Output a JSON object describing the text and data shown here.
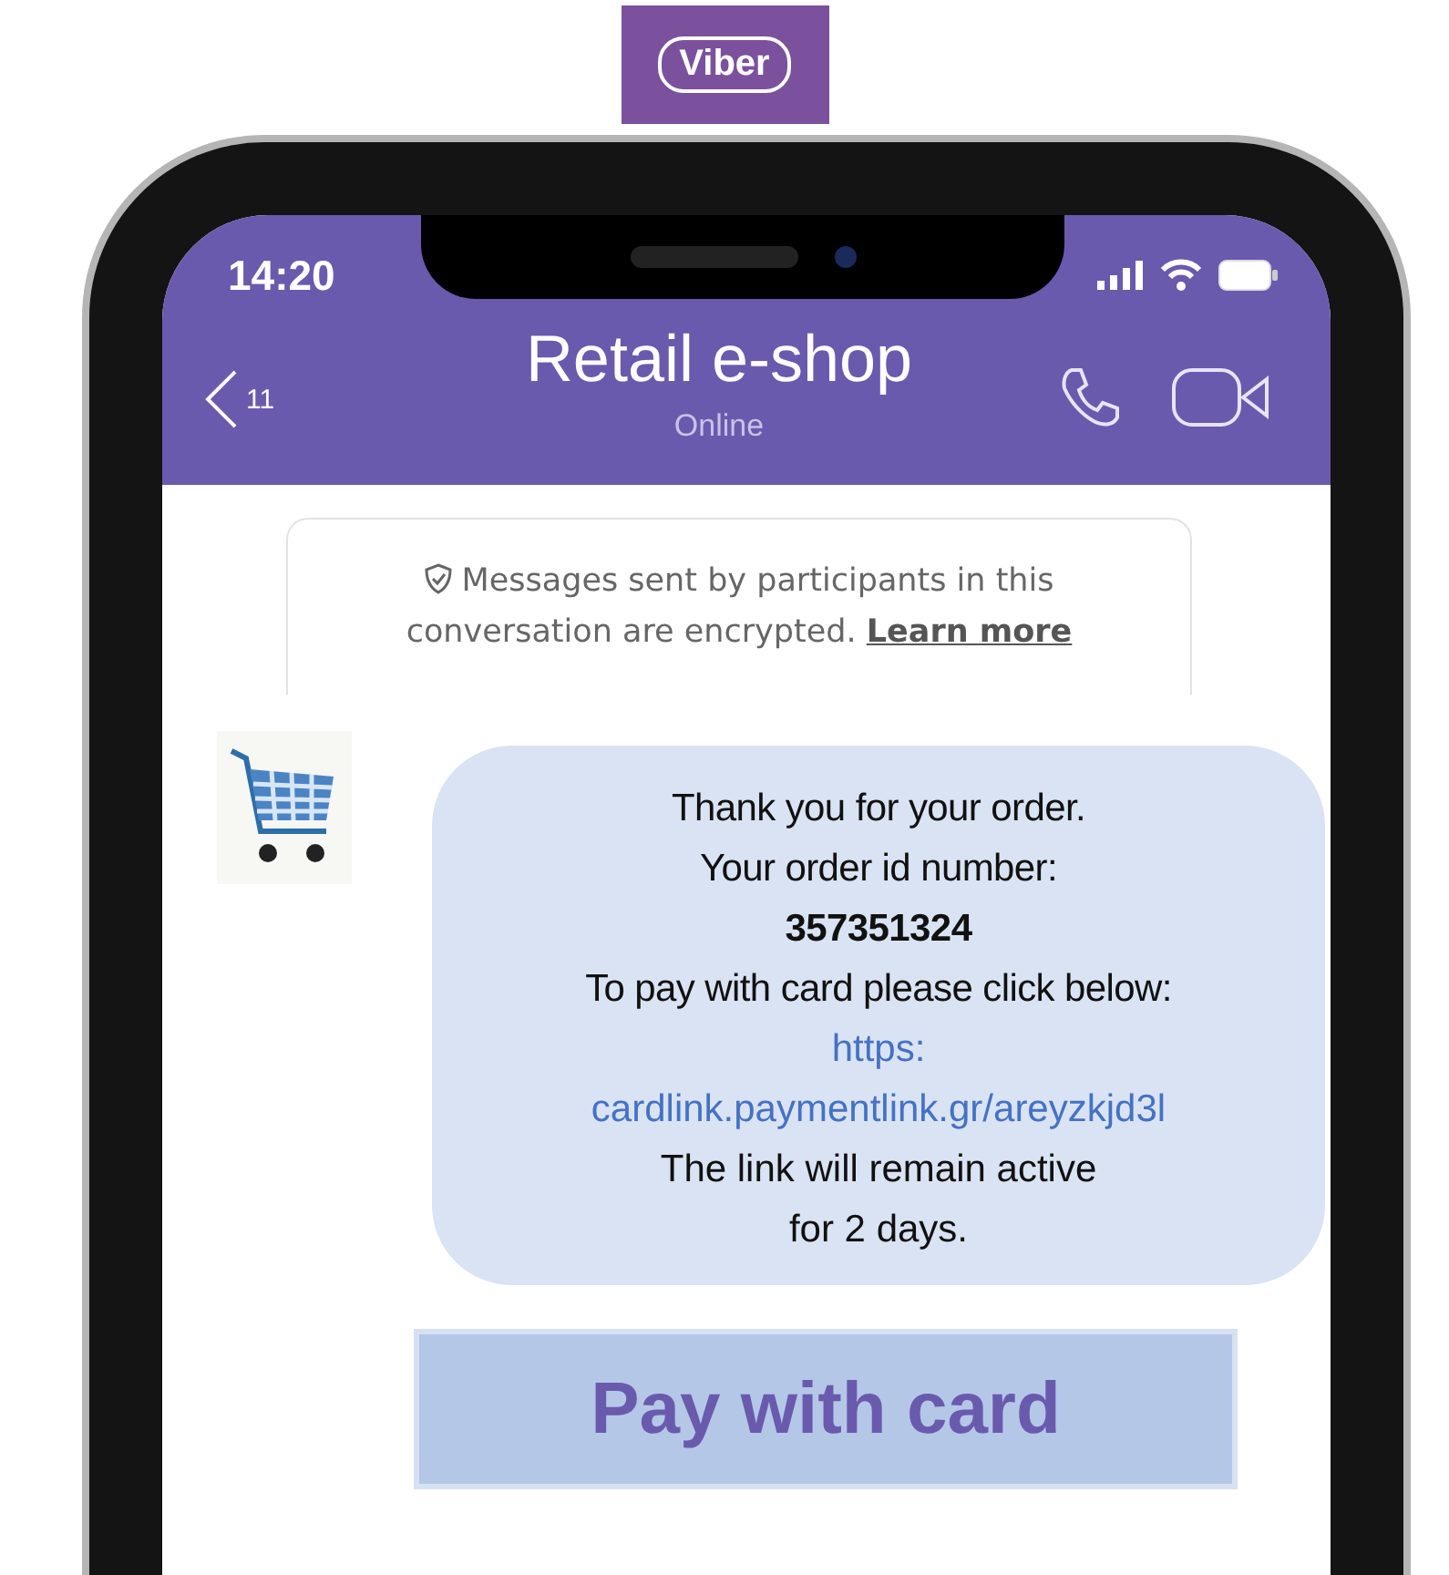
{
  "logo": {
    "text": "Viber"
  },
  "status_bar": {
    "time": "14:20"
  },
  "header": {
    "back_count": "11",
    "title": "Retail e-shop",
    "status": "Online"
  },
  "encryption_notice": {
    "text": "Messages sent by participants in this conversation are encrypted.",
    "link": "Learn more"
  },
  "message": {
    "lines": [
      {
        "kind": "text",
        "text": "Thank you for your order."
      },
      {
        "kind": "text",
        "text": "Your order id number:"
      },
      {
        "kind": "bold",
        "text": "357351324"
      },
      {
        "kind": "text",
        "text": "To pay with card please click below:"
      },
      {
        "kind": "link",
        "text": "https:"
      },
      {
        "kind": "link",
        "text": "cardlink.paymentlink.gr/areyzkjd3l"
      },
      {
        "kind": "plain",
        "text": "The link will remain active"
      },
      {
        "kind": "plain",
        "text": "for 2 days."
      }
    ]
  },
  "pay_button": {
    "label": "Pay with card"
  }
}
